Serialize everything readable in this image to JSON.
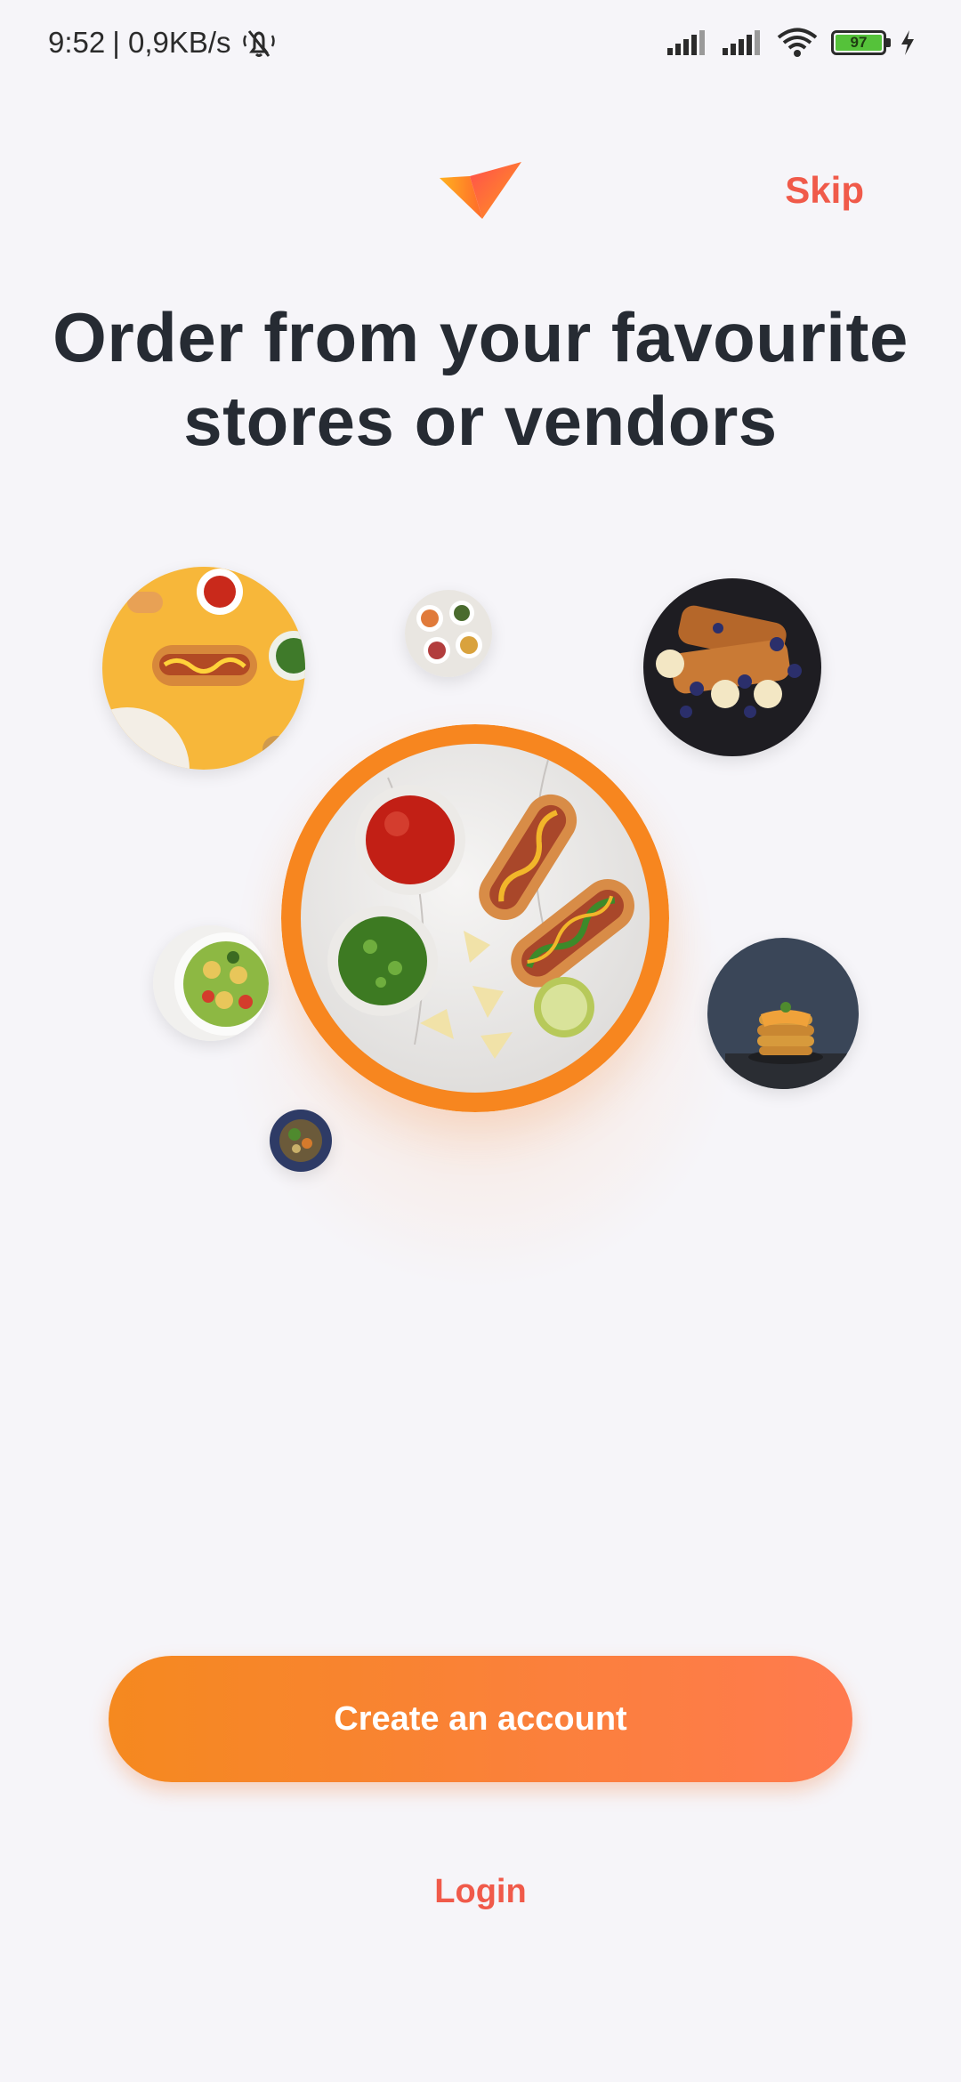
{
  "status_bar": {
    "time": "9:52",
    "network_speed": "| 0,9KB/s",
    "battery_level": "97",
    "icons": [
      "mute-icon",
      "signal-icon",
      "signal-icon",
      "wifi-icon",
      "battery-icon",
      "charging-icon"
    ]
  },
  "header": {
    "skip_label": "Skip",
    "logo": "brand-logo"
  },
  "headline": {
    "line1": "Order from your favourite",
    "line2": "stores or vendors"
  },
  "colors": {
    "accent": "#f05a4a",
    "gradient_start": "#f5891f",
    "gradient_end": "#ff7a4f",
    "text_dark": "#262b33",
    "background": "#f6f5f9"
  },
  "illustration": {
    "images": [
      "hotdog-photo",
      "salad-bowls-photo",
      "french-toast-photo",
      "hotdog-plate-photo",
      "pasta-salad-photo",
      "pancakes-photo",
      "small-bowl-photo"
    ]
  },
  "actions": {
    "create_account_label": "Create an account",
    "login_label": "Login"
  }
}
